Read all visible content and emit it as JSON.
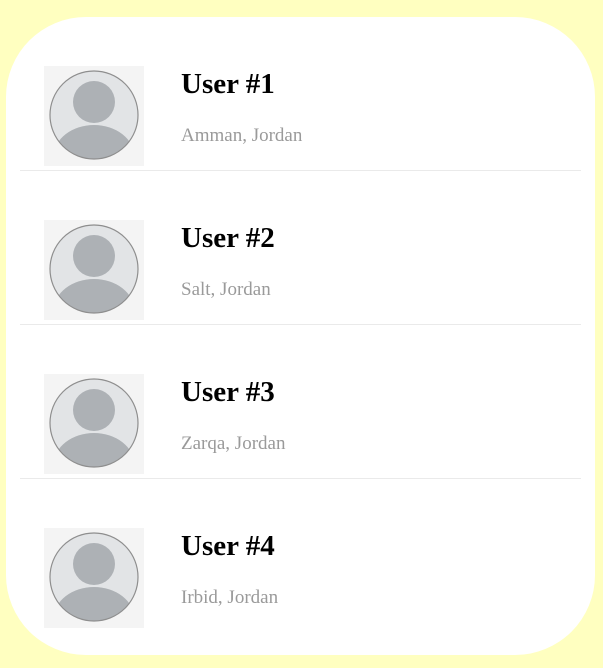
{
  "colors": {
    "page_background": "#ffffc0",
    "card_background": "#ffffff",
    "name_text": "#000000",
    "location_text": "#9a9a9a",
    "avatar_fill": "#adb1b5",
    "avatar_circle_bg": "#e2e4e6"
  },
  "users": [
    {
      "name": "User #1",
      "location": "Amman, Jordan",
      "avatar_icon": "user-placeholder-icon"
    },
    {
      "name": "User #2",
      "location": "Salt, Jordan",
      "avatar_icon": "user-placeholder-icon"
    },
    {
      "name": "User #3",
      "location": "Zarqa, Jordan",
      "avatar_icon": "user-placeholder-icon"
    },
    {
      "name": "User #4",
      "location": "Irbid, Jordan",
      "avatar_icon": "user-placeholder-icon"
    }
  ]
}
